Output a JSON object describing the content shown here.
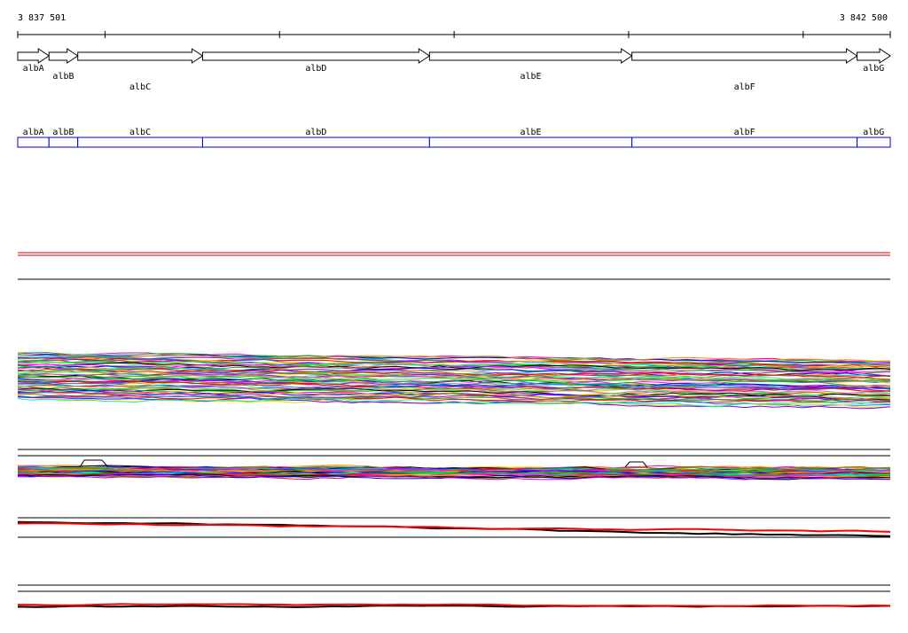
{
  "chart_data": {
    "type": "line",
    "coordinate_range": {
      "start_label": "3 837 501",
      "end_label": "3 842 500",
      "start": 3837501,
      "end": 3842500
    },
    "axis_ticks": [
      3838001,
      3839001,
      3840001,
      3841001,
      3842001
    ],
    "genes": [
      {
        "name": "albA",
        "start": 3837501,
        "end": 3837680,
        "strand": "+",
        "label_row": "top"
      },
      {
        "name": "albB",
        "start": 3837680,
        "end": 3837845,
        "strand": "+",
        "label_row": "bottom"
      },
      {
        "name": "albC",
        "start": 3837845,
        "end": 3838560,
        "strand": "+",
        "label_row": "lower"
      },
      {
        "name": "albD",
        "start": 3838560,
        "end": 3839860,
        "strand": "+",
        "label_row": "top"
      },
      {
        "name": "albE",
        "start": 3839860,
        "end": 3841020,
        "strand": "+",
        "label_row": "bottom"
      },
      {
        "name": "albF",
        "start": 3841020,
        "end": 3842310,
        "strand": "+",
        "label_row": "lower"
      },
      {
        "name": "albG",
        "start": 3842310,
        "end": 3842500,
        "strand": "+",
        "label_row": "top"
      }
    ],
    "tracks": [
      {
        "name": "",
        "kind": "double-line",
        "colors": [
          "#d00000",
          "#d00000"
        ]
      },
      {
        "name": "",
        "kind": "separator"
      },
      {
        "name": "",
        "kind": "profile-bundle",
        "series_count": 60,
        "color_palette": "multicolor"
      },
      {
        "name": "",
        "kind": "profile-bundle",
        "series_count": 40,
        "color_palette": "multicolor"
      },
      {
        "name": "",
        "kind": "profile-pair",
        "colors": [
          "#000000",
          "#ff0000"
        ]
      },
      {
        "name": "",
        "kind": "profile-pair",
        "colors": [
          "#000000",
          "#ff0000"
        ]
      }
    ],
    "grid": false,
    "legend": "none"
  },
  "colors": {
    "gene_box": "#0000cc",
    "axis": "#000000",
    "red_track": "#d00000",
    "black_series": "#000000",
    "red_series": "#ff0000"
  }
}
